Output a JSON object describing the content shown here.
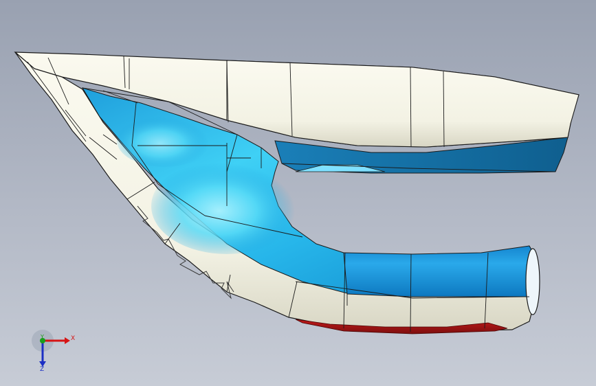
{
  "viewport": {
    "background_top": "#99a1b1",
    "background_bottom": "#c7ccd6"
  },
  "model": {
    "colors": {
      "shell": "#f4f3e6",
      "inner_surface": "#1aa0de",
      "inner_highlight": "#7fe8ff",
      "outer_lip": "#1677b0",
      "sole_accent": "#a51515",
      "edge_lines": "#1a1a1a"
    }
  },
  "triad": {
    "x_label": "X",
    "y_label": "Y",
    "z_label": "Z",
    "x_color": "#d61414",
    "y_color": "#1a9e1a",
    "z_color": "#1c2fc4"
  }
}
